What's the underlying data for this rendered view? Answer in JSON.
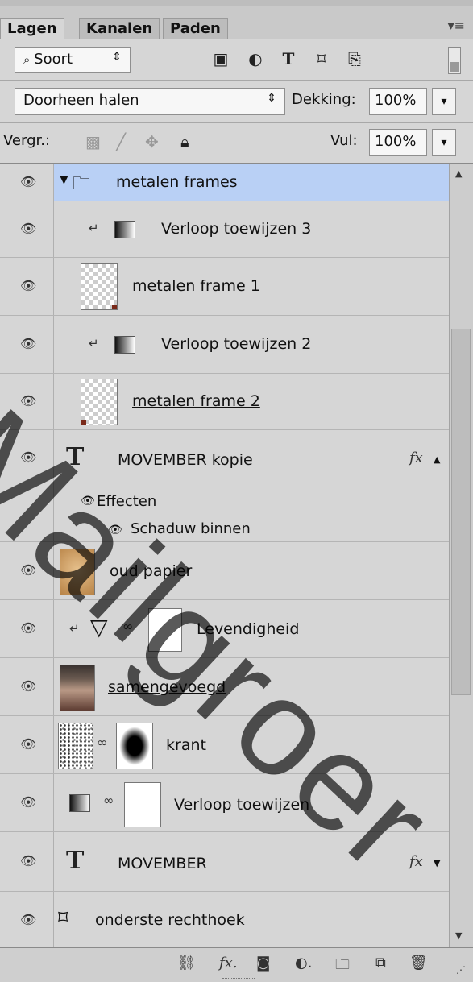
{
  "tabs": [
    "Lagen",
    "Kanalen",
    "Paden"
  ],
  "filter": {
    "kind_label": "Soort"
  },
  "blend": {
    "mode": "Doorheen halen",
    "opacity_label": "Dekking:",
    "opacity_value": "100%"
  },
  "lock": {
    "label": "Vergr.:",
    "fill_label": "Vul:",
    "fill_value": "100%"
  },
  "layers": {
    "group": "metalen frames",
    "l1": "Verloop toewijzen 3",
    "l2": "metalen frame 1",
    "l3": "Verloop toewijzen 2",
    "l4": "metalen frame 2",
    "l5": "MOVEMBER kopie",
    "l5_effects": "Effecten",
    "l5_effect1": "Schaduw binnen",
    "l6": "oud papier",
    "l7": "Levendigheid",
    "l8": "samengevoegd",
    "l9": "krant",
    "l10": "Verloop toewijzen",
    "l11": "MOVEMBER",
    "l12": "onderste rechthoek"
  },
  "watermark": "Mailgroer",
  "colors": {
    "selected": "#b9d0f5",
    "panel": "#d6d6d6"
  }
}
